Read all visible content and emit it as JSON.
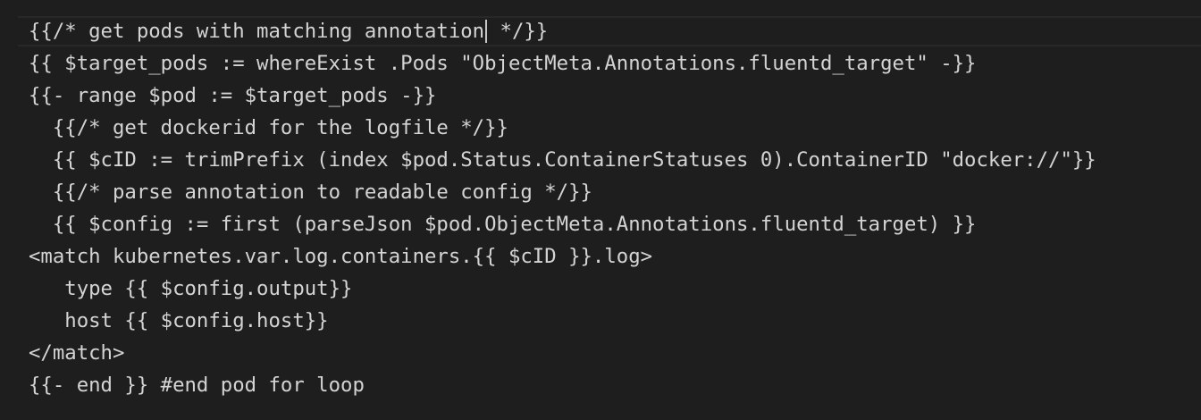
{
  "editor": {
    "cursor": {
      "line": 1,
      "after_text": "{{/* get pods with matching annotation",
      "before_text": " */}}"
    },
    "lines": [
      "{{/* get pods with matching annotation */}}",
      "{{ $target_pods := whereExist .Pods \"ObjectMeta.Annotations.fluentd_target\" -}}",
      "{{- range $pod := $target_pods -}}",
      "  {{/* get dockerid for the logfile */}}",
      "  {{ $cID := trimPrefix (index $pod.Status.ContainerStatuses 0).ContainerID \"docker://\"}}",
      "  {{/* parse annotation to readable config */}}",
      "  {{ $config := first (parseJson $pod.ObjectMeta.Annotations.fluentd_target) }}",
      "<match kubernetes.var.log.containers.{{ $cID }}.log>",
      "   type {{ $config.output}}",
      "   host {{ $config.host}}",
      "</match>",
      "{{- end }} #end pod for loop"
    ]
  },
  "colors": {
    "background": "#1e1e1e",
    "text": "#d4d4d4",
    "current_line_border": "#282828",
    "cursor": "#c8c8c8"
  }
}
